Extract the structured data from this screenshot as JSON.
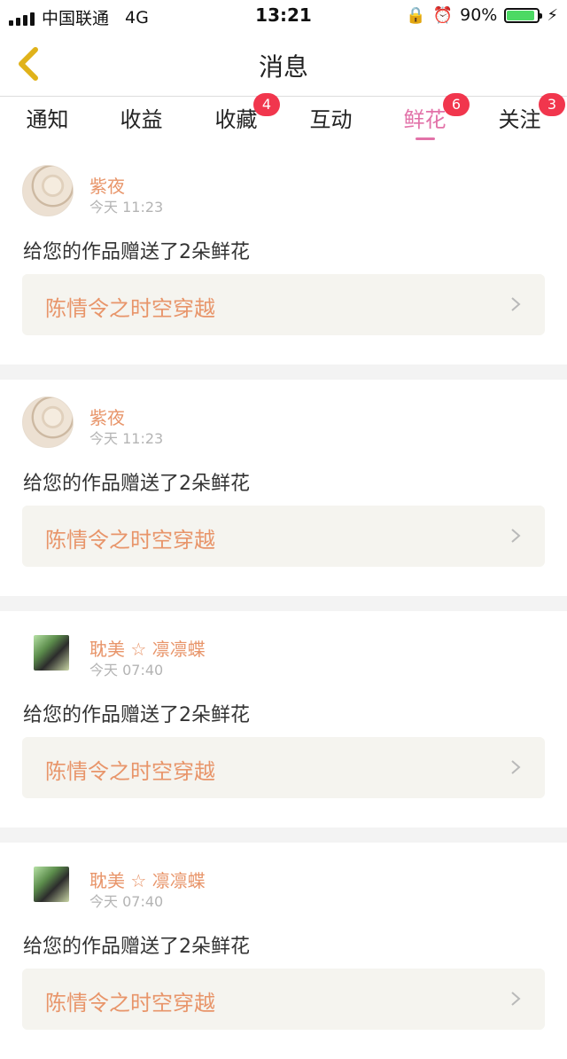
{
  "status_bar": {
    "carrier": "中国联通",
    "network": "4G",
    "time": "13:21",
    "battery": "90%"
  },
  "header": {
    "title": "消息"
  },
  "tabs": [
    {
      "label": "通知",
      "badge": ""
    },
    {
      "label": "收益",
      "badge": ""
    },
    {
      "label": "收藏",
      "badge": "4"
    },
    {
      "label": "互动",
      "badge": ""
    },
    {
      "label": "鲜花",
      "badge": "6",
      "active": true
    },
    {
      "label": "关注",
      "badge": "3"
    }
  ],
  "messages": [
    {
      "name": "紫夜",
      "time": "今天 11:23",
      "text": "给您的作品赠送了2朵鲜花",
      "work": "陈情令之时空穿越"
    },
    {
      "name": "紫夜",
      "time": "今天 11:23",
      "text": "给您的作品赠送了2朵鲜花",
      "work": "陈情令之时空穿越"
    },
    {
      "name": "耽美 ☆ 凛凛蝶",
      "time": "今天 07:40",
      "text": "给您的作品赠送了2朵鲜花",
      "work": "陈情令之时空穿越"
    },
    {
      "name": "耽美 ☆ 凛凛蝶",
      "time": "今天 07:40",
      "text": "给您的作品赠送了2朵鲜花",
      "work": "陈情令之时空穿越"
    }
  ],
  "colors": {
    "accent_pink": "#e272a8",
    "name_orange": "#e8956a",
    "badge_red": "#f1364d",
    "back_arrow": "#e0b21a"
  }
}
